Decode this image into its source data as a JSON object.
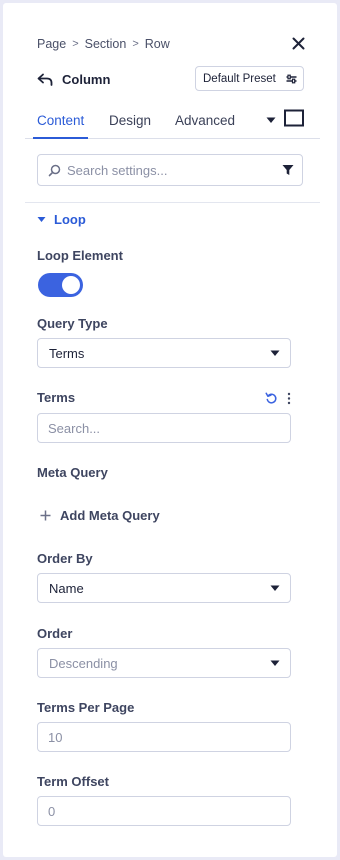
{
  "breadcrumb": [
    "Page",
    "Section",
    "Row"
  ],
  "header": {
    "back_label": "Column",
    "preset_label": "Default Preset"
  },
  "tabs": [
    {
      "label": "Content",
      "active": true
    },
    {
      "label": "Design",
      "active": false
    },
    {
      "label": "Advanced",
      "active": false
    }
  ],
  "search": {
    "placeholder": "Search settings..."
  },
  "loop_section": {
    "title": "Loop"
  },
  "fields": {
    "loop_element": {
      "label": "Loop Element",
      "enabled": true
    },
    "query_type": {
      "label": "Query Type",
      "value": "Terms"
    },
    "terms": {
      "label": "Terms",
      "placeholder": "Search..."
    },
    "meta_query": {
      "label": "Meta Query",
      "add_label": "Add Meta Query"
    },
    "order_by": {
      "label": "Order By",
      "value": "Name"
    },
    "order": {
      "label": "Order",
      "value": "Descending"
    },
    "terms_per_page": {
      "label": "Terms Per Page",
      "placeholder": "10"
    },
    "term_offset": {
      "label": "Term Offset",
      "placeholder": "0"
    }
  },
  "colors": {
    "accent": "#2b5bd7",
    "toggle_on": "#3b63e0",
    "text": "#3e4560",
    "border": "#cfd3e2"
  }
}
